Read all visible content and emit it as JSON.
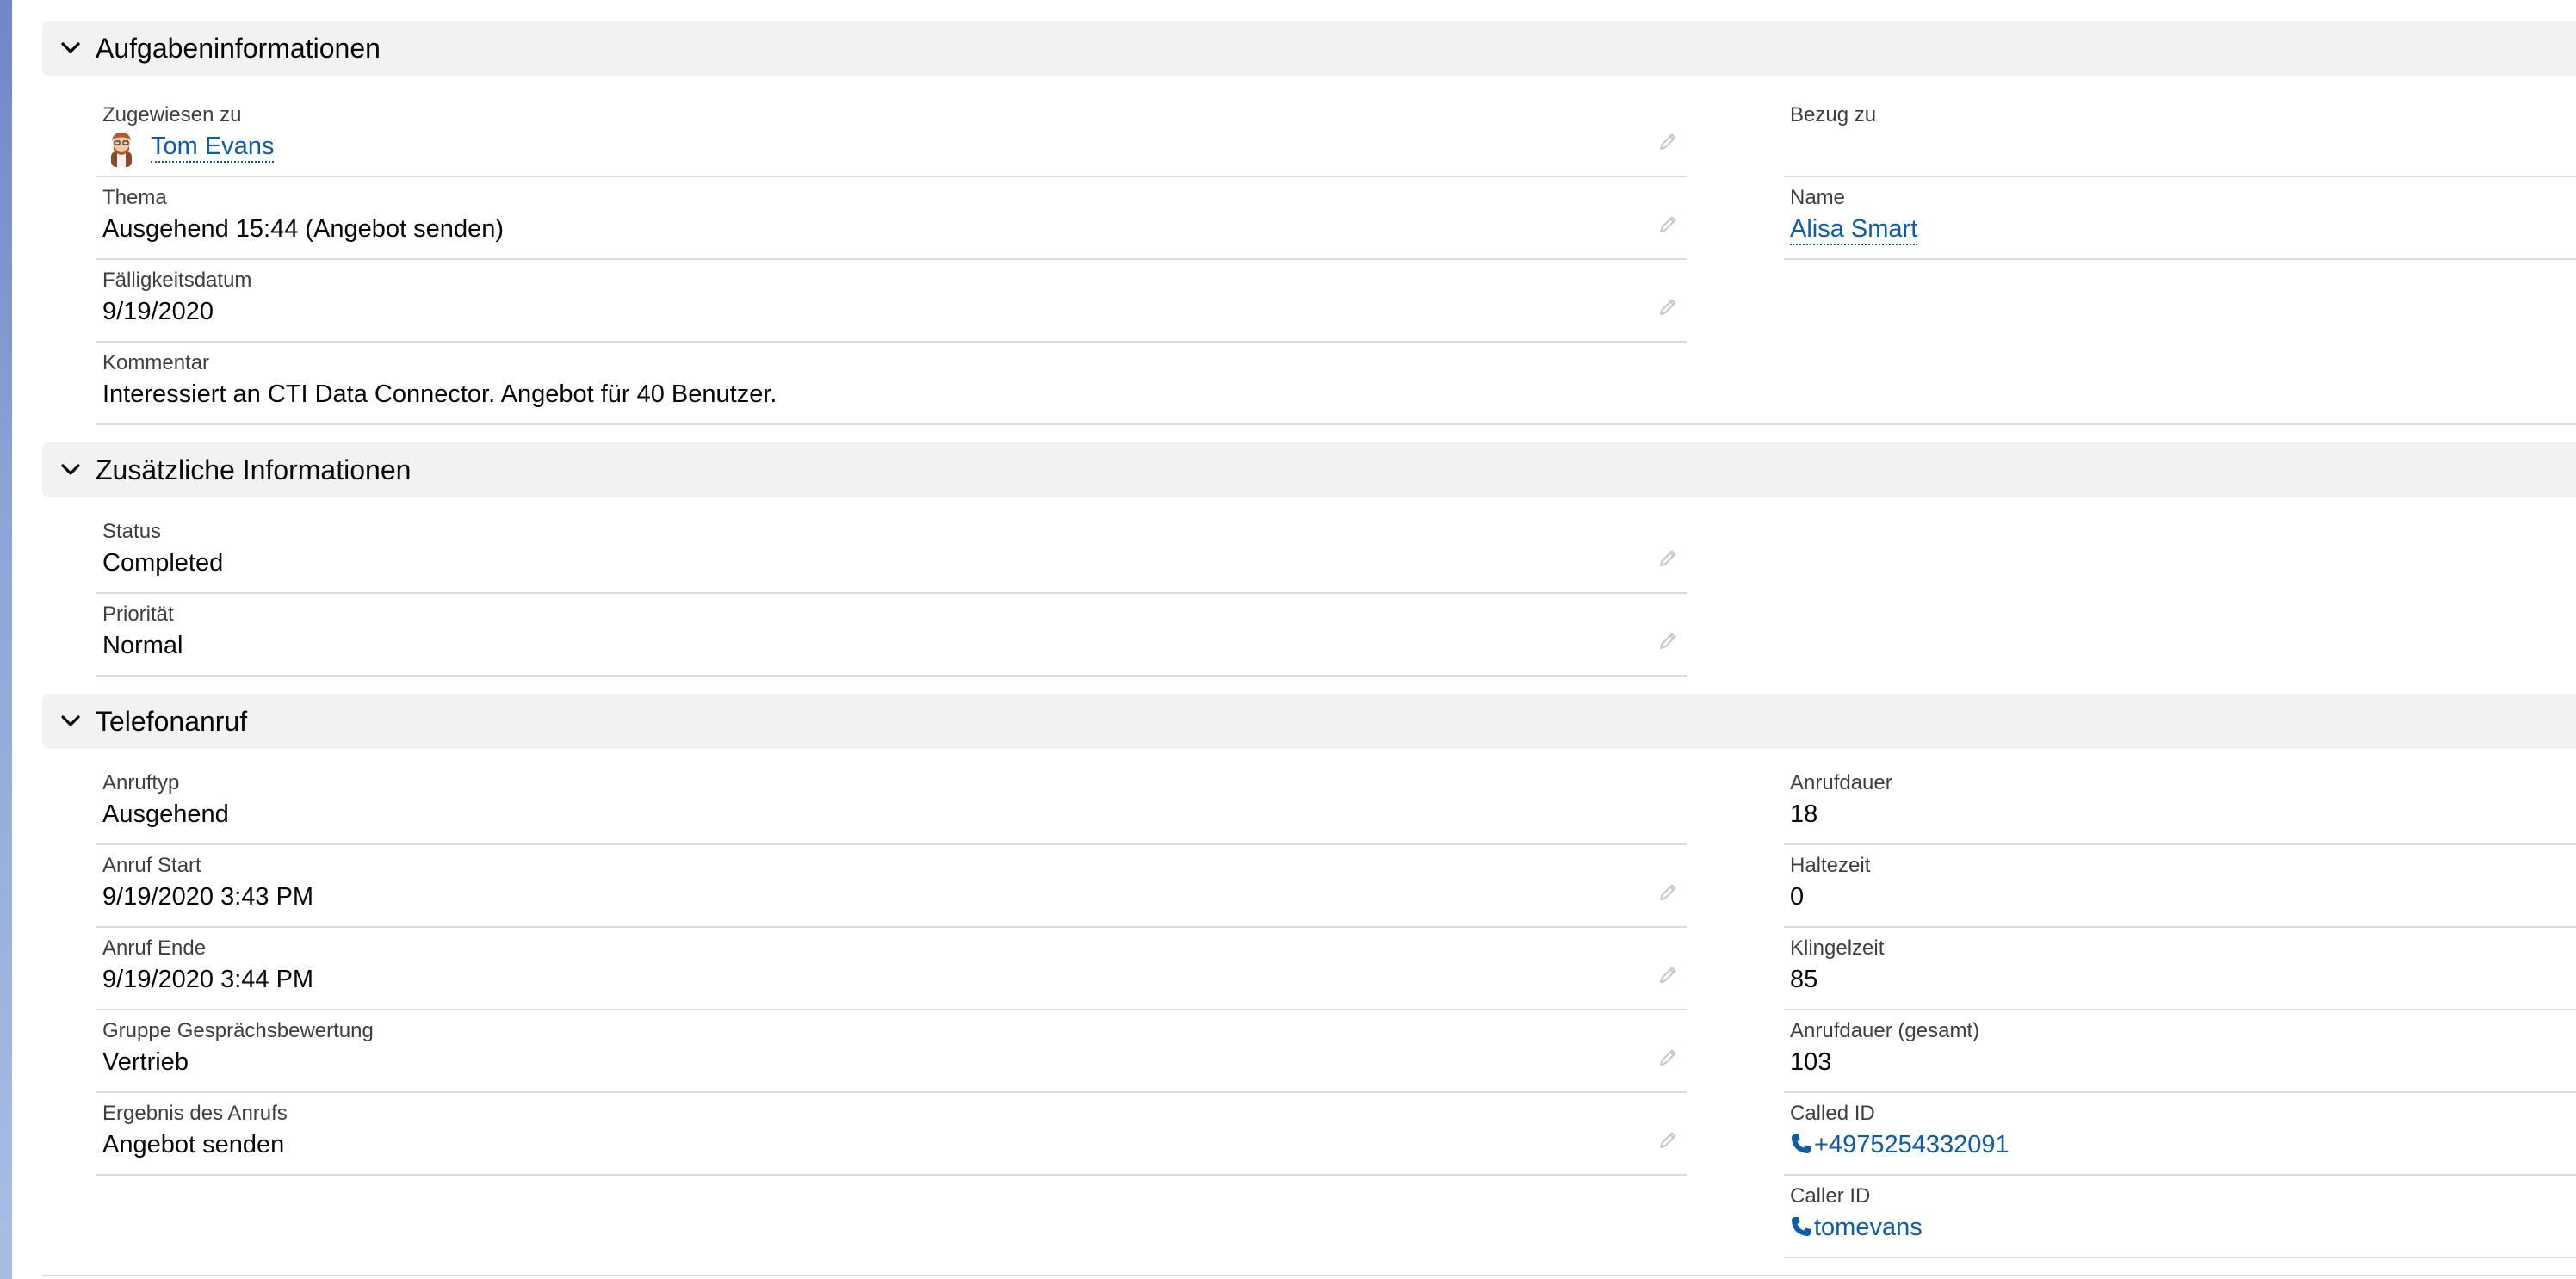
{
  "sections": [
    {
      "title": "Aufgabeninformationen",
      "fields": {
        "assigned_to": {
          "label": "Zugewiesen zu",
          "value": "Tom Evans"
        },
        "related_to": {
          "label": "Bezug zu",
          "value": ""
        },
        "subject": {
          "label": "Thema",
          "value": "Ausgehend 15:44 (Angebot senden)"
        },
        "name": {
          "label": "Name",
          "value": "Alisa Smart"
        },
        "due_date": {
          "label": "Fälligkeitsdatum",
          "value": "9/19/2020"
        },
        "comment": {
          "label": "Kommentar",
          "value": "Interessiert an CTI Data Connector. Angebot für 40 Benutzer."
        }
      }
    },
    {
      "title": "Zusätzliche Informationen",
      "fields": {
        "status": {
          "label": "Status",
          "value": "Completed"
        },
        "priority": {
          "label": "Priorität",
          "value": "Normal"
        }
      }
    },
    {
      "title": "Telefonanruf",
      "fields": {
        "call_type": {
          "label": "Anruftyp",
          "value": "Ausgehend"
        },
        "call_duration": {
          "label": "Anrufdauer",
          "value": "18"
        },
        "call_start": {
          "label": "Anruf Start",
          "value": "9/19/2020 3:43 PM"
        },
        "hold_time": {
          "label": "Haltezeit",
          "value": "0"
        },
        "call_end": {
          "label": "Anruf Ende",
          "value": "9/19/2020 3:44 PM"
        },
        "ring_time": {
          "label": "Klingelzeit",
          "value": "85"
        },
        "rating_group": {
          "label": "Gruppe Gesprächsbewertung",
          "value": "Vertrieb"
        },
        "total_duration": {
          "label": "Anrufdauer (gesamt)",
          "value": "103"
        },
        "call_result": {
          "label": "Ergebnis des Anrufs",
          "value": "Angebot senden"
        },
        "called_id": {
          "label": "Called ID",
          "value": "+4975254332091"
        },
        "caller_id": {
          "label": "Caller ID",
          "value": "tomevans"
        }
      }
    }
  ],
  "icons": {
    "chevron": "chevron-down-icon",
    "edit": "pencil-icon",
    "phone": "phone-icon",
    "avatar": "avatar"
  },
  "colors": {
    "link": "#0b5cab",
    "section_bg": "#f3f2f2",
    "divider": "#dddbda",
    "label": "#3e3e3c",
    "pencil": "#c9c7c5"
  }
}
